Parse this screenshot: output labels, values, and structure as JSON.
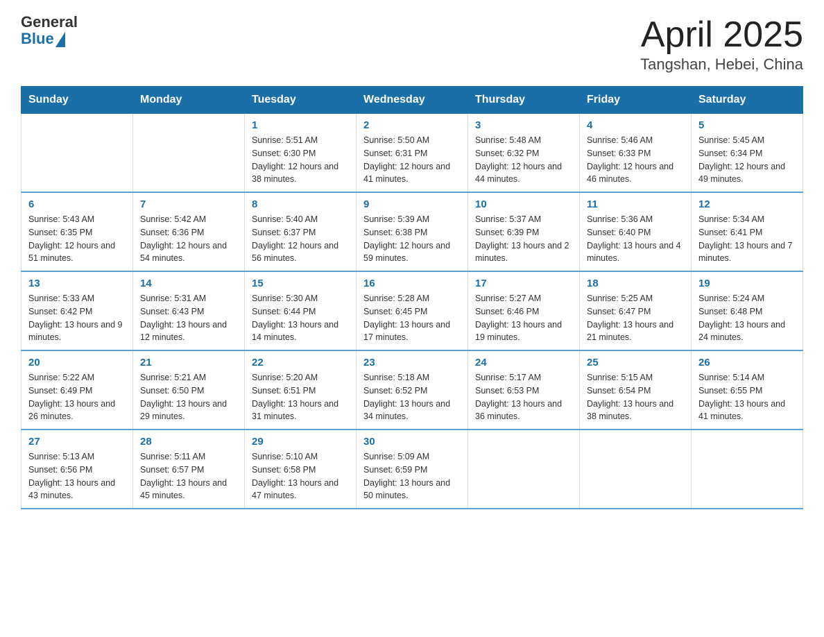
{
  "header": {
    "logo_general": "General",
    "logo_blue": "Blue",
    "title": "April 2025",
    "subtitle": "Tangshan, Hebei, China"
  },
  "weekdays": [
    "Sunday",
    "Monday",
    "Tuesday",
    "Wednesday",
    "Thursday",
    "Friday",
    "Saturday"
  ],
  "weeks": [
    [
      {
        "day": "",
        "sunrise": "",
        "sunset": "",
        "daylight": ""
      },
      {
        "day": "",
        "sunrise": "",
        "sunset": "",
        "daylight": ""
      },
      {
        "day": "1",
        "sunrise": "Sunrise: 5:51 AM",
        "sunset": "Sunset: 6:30 PM",
        "daylight": "Daylight: 12 hours and 38 minutes."
      },
      {
        "day": "2",
        "sunrise": "Sunrise: 5:50 AM",
        "sunset": "Sunset: 6:31 PM",
        "daylight": "Daylight: 12 hours and 41 minutes."
      },
      {
        "day": "3",
        "sunrise": "Sunrise: 5:48 AM",
        "sunset": "Sunset: 6:32 PM",
        "daylight": "Daylight: 12 hours and 44 minutes."
      },
      {
        "day": "4",
        "sunrise": "Sunrise: 5:46 AM",
        "sunset": "Sunset: 6:33 PM",
        "daylight": "Daylight: 12 hours and 46 minutes."
      },
      {
        "day": "5",
        "sunrise": "Sunrise: 5:45 AM",
        "sunset": "Sunset: 6:34 PM",
        "daylight": "Daylight: 12 hours and 49 minutes."
      }
    ],
    [
      {
        "day": "6",
        "sunrise": "Sunrise: 5:43 AM",
        "sunset": "Sunset: 6:35 PM",
        "daylight": "Daylight: 12 hours and 51 minutes."
      },
      {
        "day": "7",
        "sunrise": "Sunrise: 5:42 AM",
        "sunset": "Sunset: 6:36 PM",
        "daylight": "Daylight: 12 hours and 54 minutes."
      },
      {
        "day": "8",
        "sunrise": "Sunrise: 5:40 AM",
        "sunset": "Sunset: 6:37 PM",
        "daylight": "Daylight: 12 hours and 56 minutes."
      },
      {
        "day": "9",
        "sunrise": "Sunrise: 5:39 AM",
        "sunset": "Sunset: 6:38 PM",
        "daylight": "Daylight: 12 hours and 59 minutes."
      },
      {
        "day": "10",
        "sunrise": "Sunrise: 5:37 AM",
        "sunset": "Sunset: 6:39 PM",
        "daylight": "Daylight: 13 hours and 2 minutes."
      },
      {
        "day": "11",
        "sunrise": "Sunrise: 5:36 AM",
        "sunset": "Sunset: 6:40 PM",
        "daylight": "Daylight: 13 hours and 4 minutes."
      },
      {
        "day": "12",
        "sunrise": "Sunrise: 5:34 AM",
        "sunset": "Sunset: 6:41 PM",
        "daylight": "Daylight: 13 hours and 7 minutes."
      }
    ],
    [
      {
        "day": "13",
        "sunrise": "Sunrise: 5:33 AM",
        "sunset": "Sunset: 6:42 PM",
        "daylight": "Daylight: 13 hours and 9 minutes."
      },
      {
        "day": "14",
        "sunrise": "Sunrise: 5:31 AM",
        "sunset": "Sunset: 6:43 PM",
        "daylight": "Daylight: 13 hours and 12 minutes."
      },
      {
        "day": "15",
        "sunrise": "Sunrise: 5:30 AM",
        "sunset": "Sunset: 6:44 PM",
        "daylight": "Daylight: 13 hours and 14 minutes."
      },
      {
        "day": "16",
        "sunrise": "Sunrise: 5:28 AM",
        "sunset": "Sunset: 6:45 PM",
        "daylight": "Daylight: 13 hours and 17 minutes."
      },
      {
        "day": "17",
        "sunrise": "Sunrise: 5:27 AM",
        "sunset": "Sunset: 6:46 PM",
        "daylight": "Daylight: 13 hours and 19 minutes."
      },
      {
        "day": "18",
        "sunrise": "Sunrise: 5:25 AM",
        "sunset": "Sunset: 6:47 PM",
        "daylight": "Daylight: 13 hours and 21 minutes."
      },
      {
        "day": "19",
        "sunrise": "Sunrise: 5:24 AM",
        "sunset": "Sunset: 6:48 PM",
        "daylight": "Daylight: 13 hours and 24 minutes."
      }
    ],
    [
      {
        "day": "20",
        "sunrise": "Sunrise: 5:22 AM",
        "sunset": "Sunset: 6:49 PM",
        "daylight": "Daylight: 13 hours and 26 minutes."
      },
      {
        "day": "21",
        "sunrise": "Sunrise: 5:21 AM",
        "sunset": "Sunset: 6:50 PM",
        "daylight": "Daylight: 13 hours and 29 minutes."
      },
      {
        "day": "22",
        "sunrise": "Sunrise: 5:20 AM",
        "sunset": "Sunset: 6:51 PM",
        "daylight": "Daylight: 13 hours and 31 minutes."
      },
      {
        "day": "23",
        "sunrise": "Sunrise: 5:18 AM",
        "sunset": "Sunset: 6:52 PM",
        "daylight": "Daylight: 13 hours and 34 minutes."
      },
      {
        "day": "24",
        "sunrise": "Sunrise: 5:17 AM",
        "sunset": "Sunset: 6:53 PM",
        "daylight": "Daylight: 13 hours and 36 minutes."
      },
      {
        "day": "25",
        "sunrise": "Sunrise: 5:15 AM",
        "sunset": "Sunset: 6:54 PM",
        "daylight": "Daylight: 13 hours and 38 minutes."
      },
      {
        "day": "26",
        "sunrise": "Sunrise: 5:14 AM",
        "sunset": "Sunset: 6:55 PM",
        "daylight": "Daylight: 13 hours and 41 minutes."
      }
    ],
    [
      {
        "day": "27",
        "sunrise": "Sunrise: 5:13 AM",
        "sunset": "Sunset: 6:56 PM",
        "daylight": "Daylight: 13 hours and 43 minutes."
      },
      {
        "day": "28",
        "sunrise": "Sunrise: 5:11 AM",
        "sunset": "Sunset: 6:57 PM",
        "daylight": "Daylight: 13 hours and 45 minutes."
      },
      {
        "day": "29",
        "sunrise": "Sunrise: 5:10 AM",
        "sunset": "Sunset: 6:58 PM",
        "daylight": "Daylight: 13 hours and 47 minutes."
      },
      {
        "day": "30",
        "sunrise": "Sunrise: 5:09 AM",
        "sunset": "Sunset: 6:59 PM",
        "daylight": "Daylight: 13 hours and 50 minutes."
      },
      {
        "day": "",
        "sunrise": "",
        "sunset": "",
        "daylight": ""
      },
      {
        "day": "",
        "sunrise": "",
        "sunset": "",
        "daylight": ""
      },
      {
        "day": "",
        "sunrise": "",
        "sunset": "",
        "daylight": ""
      }
    ]
  ]
}
